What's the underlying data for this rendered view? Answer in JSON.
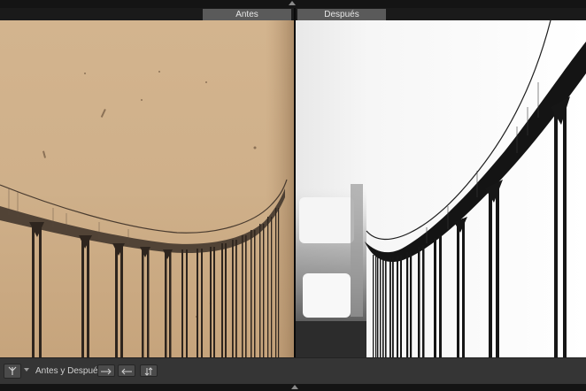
{
  "labels": {
    "before": "Antes",
    "after": "Después"
  },
  "toolbar": {
    "mode_label": "Antes y Después:",
    "view_mode_icon": "before-after-split-icon",
    "buttons": [
      {
        "name": "copy-before-to-after",
        "icon": "arrow-right-icon"
      },
      {
        "name": "copy-after-to-before",
        "icon": "arrow-left-icon"
      },
      {
        "name": "swap-before-after",
        "icon": "swap-icon"
      }
    ]
  },
  "colors": {
    "before_tint": "#c9ab86",
    "after_background": "#ffffff",
    "label_bar": "#5a5a5a",
    "toolbar": "#353535"
  }
}
